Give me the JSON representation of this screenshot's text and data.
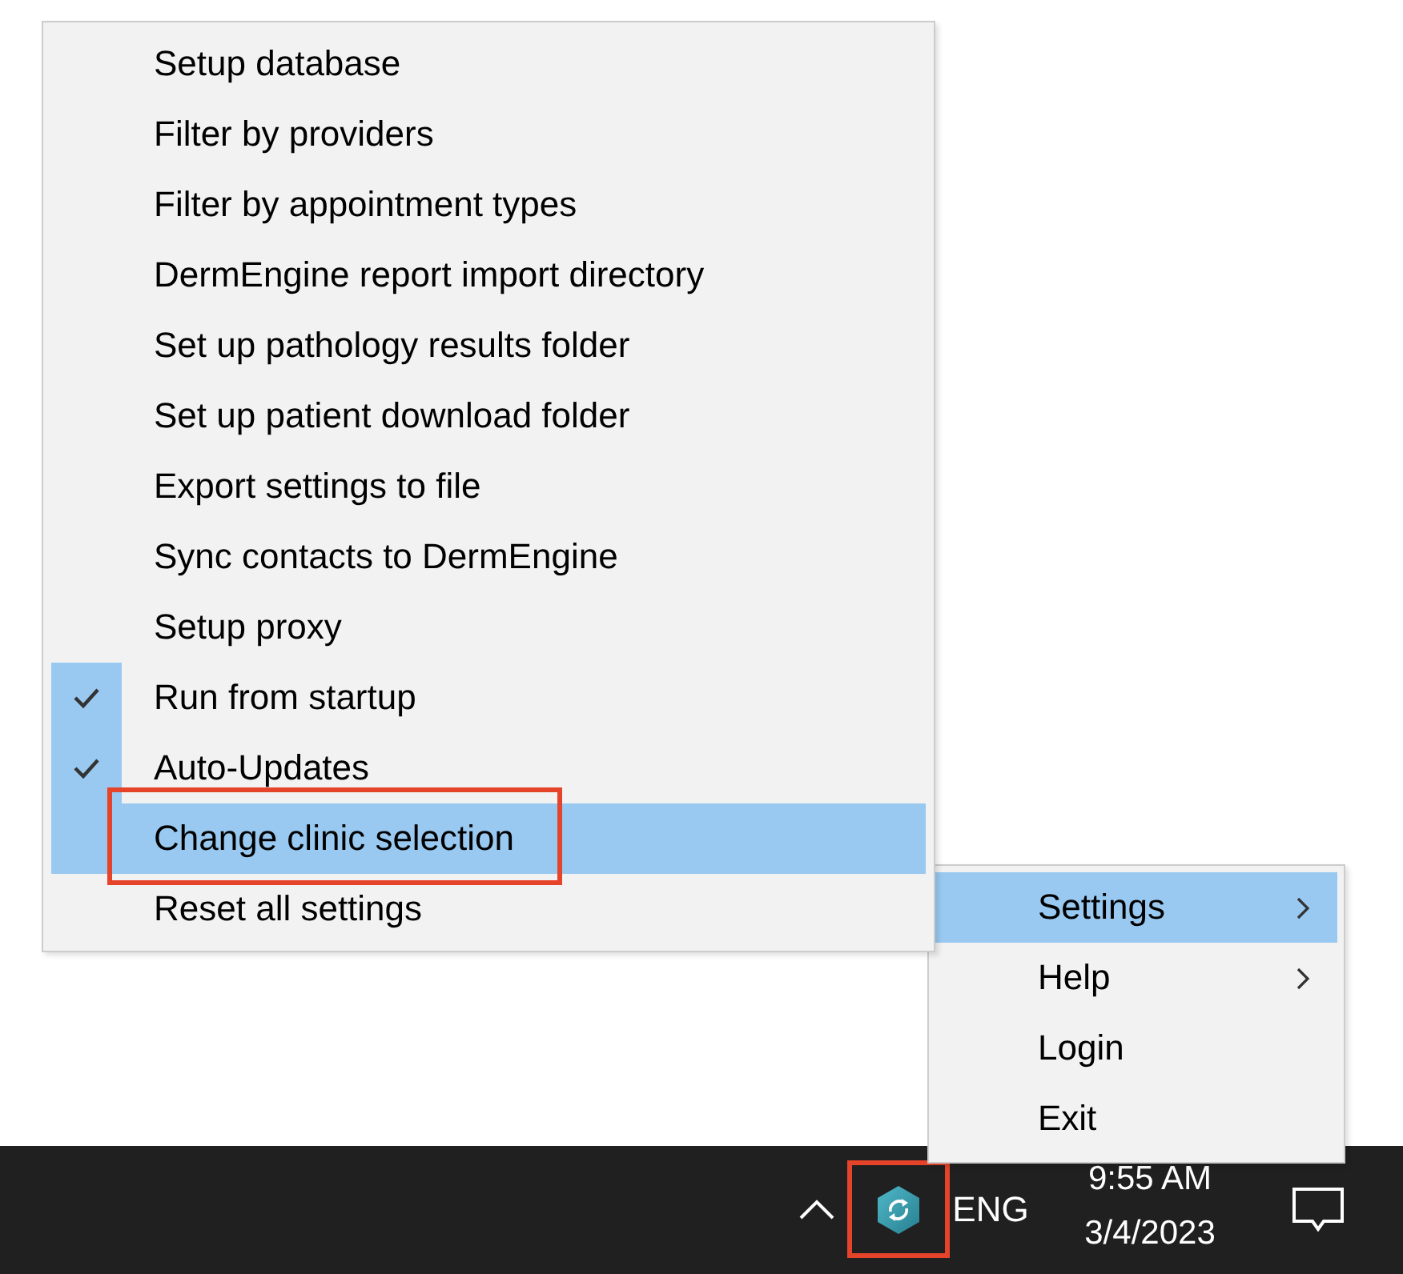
{
  "submenu": {
    "items": [
      {
        "label": "Setup database",
        "checked": false,
        "selected": false,
        "callout": false
      },
      {
        "label": "Filter by providers",
        "checked": false,
        "selected": false,
        "callout": false
      },
      {
        "label": "Filter by appointment types",
        "checked": false,
        "selected": false,
        "callout": false
      },
      {
        "label": "DermEngine report import directory",
        "checked": false,
        "selected": false,
        "callout": false
      },
      {
        "label": "Set up pathology results folder",
        "checked": false,
        "selected": false,
        "callout": false
      },
      {
        "label": "Set up patient download folder",
        "checked": false,
        "selected": false,
        "callout": false
      },
      {
        "label": "Export settings to file",
        "checked": false,
        "selected": false,
        "callout": false
      },
      {
        "label": "Sync contacts to DermEngine",
        "checked": false,
        "selected": false,
        "callout": false
      },
      {
        "label": "Setup proxy",
        "checked": false,
        "selected": false,
        "callout": false
      },
      {
        "label": "Run from startup",
        "checked": true,
        "selected": false,
        "callout": false
      },
      {
        "label": "Auto-Updates",
        "checked": true,
        "selected": false,
        "callout": false
      },
      {
        "label": "Change clinic selection",
        "checked": false,
        "selected": true,
        "callout": true
      },
      {
        "label": "Reset all settings",
        "checked": false,
        "selected": false,
        "callout": false
      }
    ]
  },
  "menu": {
    "items": [
      {
        "label": "Settings",
        "selected": true,
        "has_submenu": true
      },
      {
        "label": "Help",
        "selected": false,
        "has_submenu": true
      },
      {
        "label": "Login",
        "selected": false,
        "has_submenu": false
      },
      {
        "label": "Exit",
        "selected": false,
        "has_submenu": false
      }
    ]
  },
  "taskbar": {
    "app_icon": {
      "callout": true
    },
    "language": "ENG",
    "time": "9:55 AM",
    "date": "3/4/2023"
  }
}
